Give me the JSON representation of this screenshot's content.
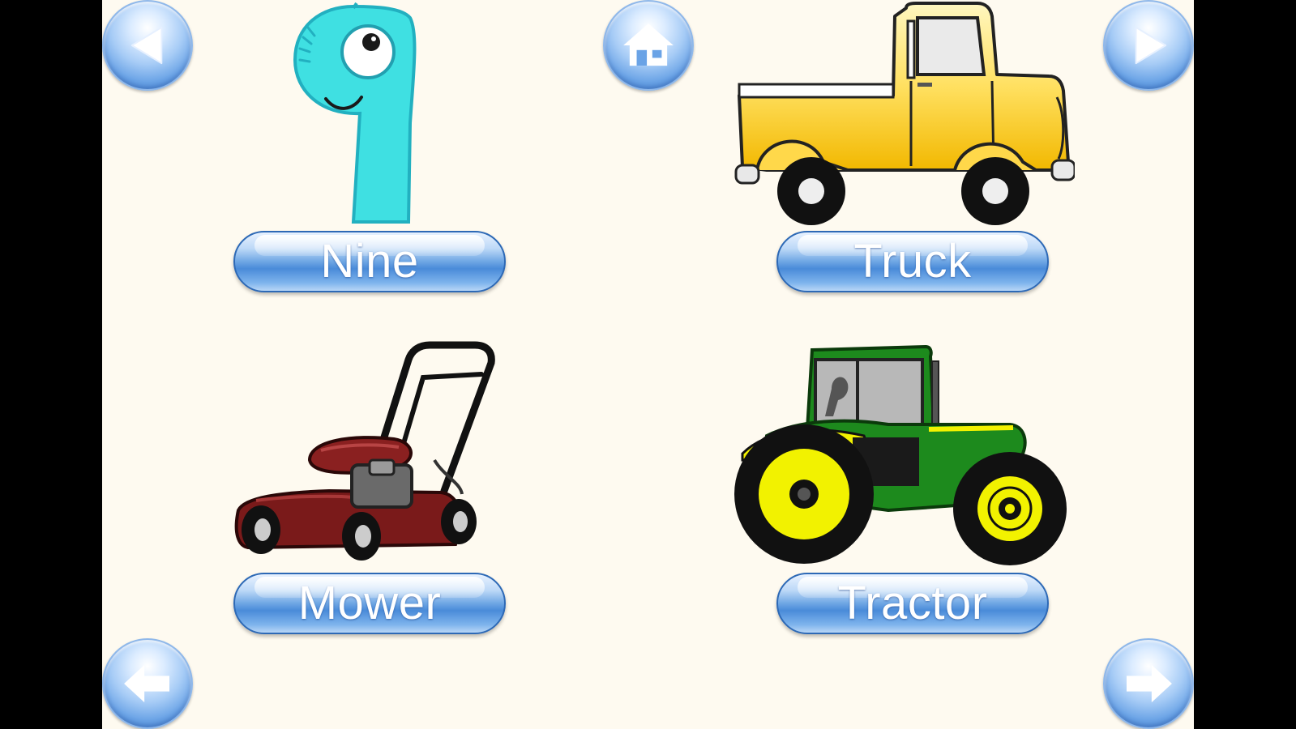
{
  "navigation": {
    "back_icon": "left-triangle-icon",
    "home_icon": "home-icon",
    "next_icon": "right-triangle-icon",
    "previous_page_icon": "left-arrow-icon",
    "next_page_icon": "right-arrow-icon"
  },
  "cards": [
    {
      "label": "Nine",
      "picture": "number-nine-character"
    },
    {
      "label": "Truck",
      "picture": "yellow-pickup-truck"
    },
    {
      "label": "Mower",
      "picture": "red-lawn-mower"
    },
    {
      "label": "Tractor",
      "picture": "green-tractor"
    }
  ],
  "colors": {
    "background": "#fefaf0",
    "button_blue": "#4a8bd9"
  }
}
